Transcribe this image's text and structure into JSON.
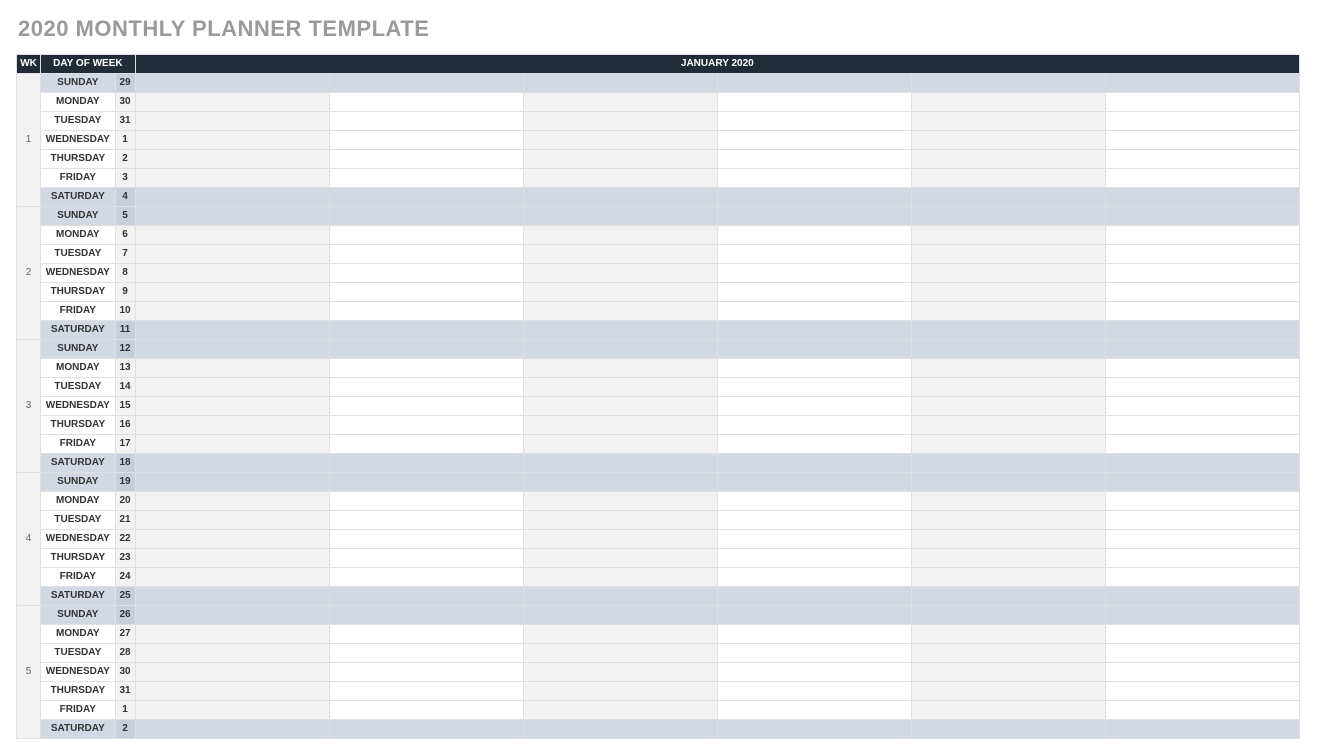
{
  "title": "2020 MONTHLY PLANNER TEMPLATE",
  "headers": {
    "wk": "WK",
    "dow": "DAY OF WEEK",
    "month": "JANUARY 2020"
  },
  "entry_columns": 6,
  "weeks": [
    {
      "num": "1",
      "days": [
        {
          "dow": "SUNDAY",
          "date": "29",
          "shade": "weekend"
        },
        {
          "dow": "MONDAY",
          "date": "30",
          "shade": "alt"
        },
        {
          "dow": "TUESDAY",
          "date": "31",
          "shade": ""
        },
        {
          "dow": "WEDNESDAY",
          "date": "1",
          "shade": "alt"
        },
        {
          "dow": "THURSDAY",
          "date": "2",
          "shade": ""
        },
        {
          "dow": "FRIDAY",
          "date": "3",
          "shade": "alt"
        },
        {
          "dow": "SATURDAY",
          "date": "4",
          "shade": "weekend"
        }
      ]
    },
    {
      "num": "2",
      "days": [
        {
          "dow": "SUNDAY",
          "date": "5",
          "shade": "weekend"
        },
        {
          "dow": "MONDAY",
          "date": "6",
          "shade": ""
        },
        {
          "dow": "TUESDAY",
          "date": "7",
          "shade": "alt"
        },
        {
          "dow": "WEDNESDAY",
          "date": "8",
          "shade": ""
        },
        {
          "dow": "THURSDAY",
          "date": "9",
          "shade": "alt"
        },
        {
          "dow": "FRIDAY",
          "date": "10",
          "shade": ""
        },
        {
          "dow": "SATURDAY",
          "date": "11",
          "shade": "weekend"
        }
      ]
    },
    {
      "num": "3",
      "days": [
        {
          "dow": "SUNDAY",
          "date": "12",
          "shade": "weekend"
        },
        {
          "dow": "MONDAY",
          "date": "13",
          "shade": ""
        },
        {
          "dow": "TUESDAY",
          "date": "14",
          "shade": "alt"
        },
        {
          "dow": "WEDNESDAY",
          "date": "15",
          "shade": ""
        },
        {
          "dow": "THURSDAY",
          "date": "16",
          "shade": "alt"
        },
        {
          "dow": "FRIDAY",
          "date": "17",
          "shade": ""
        },
        {
          "dow": "SATURDAY",
          "date": "18",
          "shade": "weekend"
        }
      ]
    },
    {
      "num": "4",
      "days": [
        {
          "dow": "SUNDAY",
          "date": "19",
          "shade": "weekend"
        },
        {
          "dow": "MONDAY",
          "date": "20",
          "shade": ""
        },
        {
          "dow": "TUESDAY",
          "date": "21",
          "shade": "alt"
        },
        {
          "dow": "WEDNESDAY",
          "date": "22",
          "shade": ""
        },
        {
          "dow": "THURSDAY",
          "date": "23",
          "shade": "alt"
        },
        {
          "dow": "FRIDAY",
          "date": "24",
          "shade": ""
        },
        {
          "dow": "SATURDAY",
          "date": "25",
          "shade": "weekend"
        }
      ]
    },
    {
      "num": "5",
      "days": [
        {
          "dow": "SUNDAY",
          "date": "26",
          "shade": "weekend"
        },
        {
          "dow": "MONDAY",
          "date": "27",
          "shade": ""
        },
        {
          "dow": "TUESDAY",
          "date": "28",
          "shade": "alt"
        },
        {
          "dow": "WEDNESDAY",
          "date": "30",
          "shade": ""
        },
        {
          "dow": "THURSDAY",
          "date": "31",
          "shade": "alt"
        },
        {
          "dow": "FRIDAY",
          "date": "1",
          "shade": ""
        },
        {
          "dow": "SATURDAY",
          "date": "2",
          "shade": "weekend"
        }
      ]
    }
  ]
}
